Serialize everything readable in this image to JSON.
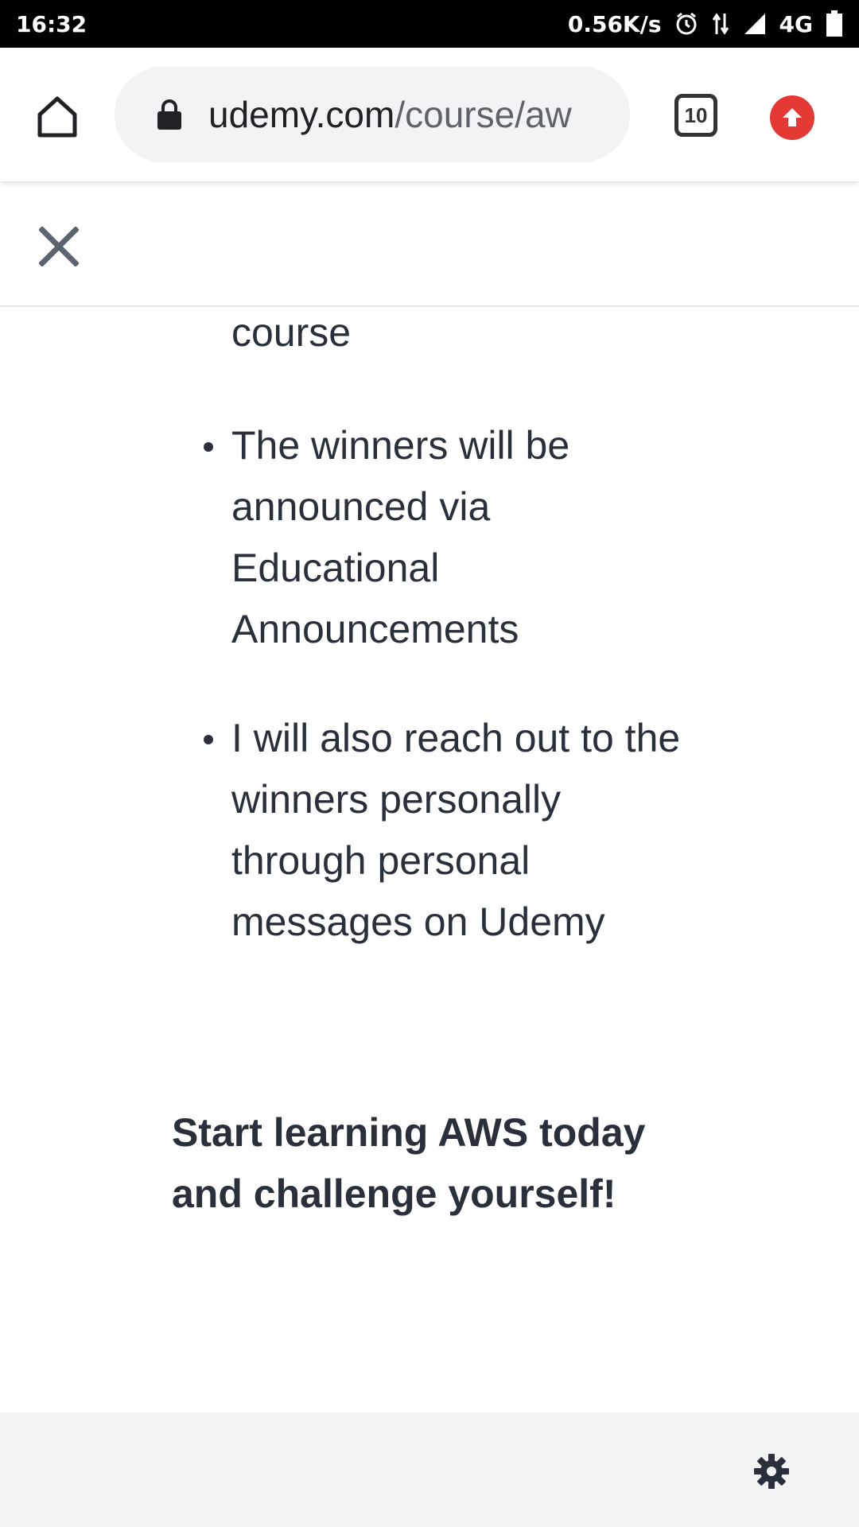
{
  "status_bar": {
    "time": "16:32",
    "net_speed": "0.56K/s",
    "network_type": "4G",
    "icons": [
      "alarm-icon",
      "data-arrows-icon",
      "signal-icon",
      "battery-icon"
    ]
  },
  "browser": {
    "url_domain": "udemy.com",
    "url_path": "/course/aw",
    "tab_count": "10",
    "icons": [
      "home-icon",
      "lock-icon",
      "tabs-icon",
      "update-icon"
    ]
  },
  "modal": {
    "close_icon": "close-icon",
    "continued_text": "course",
    "bullets": [
      "The winners will be announced via Educational Announcements",
      "I will also reach out to the winners personally through personal messages on Udemy"
    ],
    "cta": "Start learning AWS today and challenge yourself!"
  },
  "footer": {
    "settings_icon": "gear-icon"
  },
  "colors": {
    "text": "#29303b",
    "update_badge": "#e53935",
    "footer_bg": "#f2f3f5",
    "omnibox_bg": "#f1f3f4"
  }
}
